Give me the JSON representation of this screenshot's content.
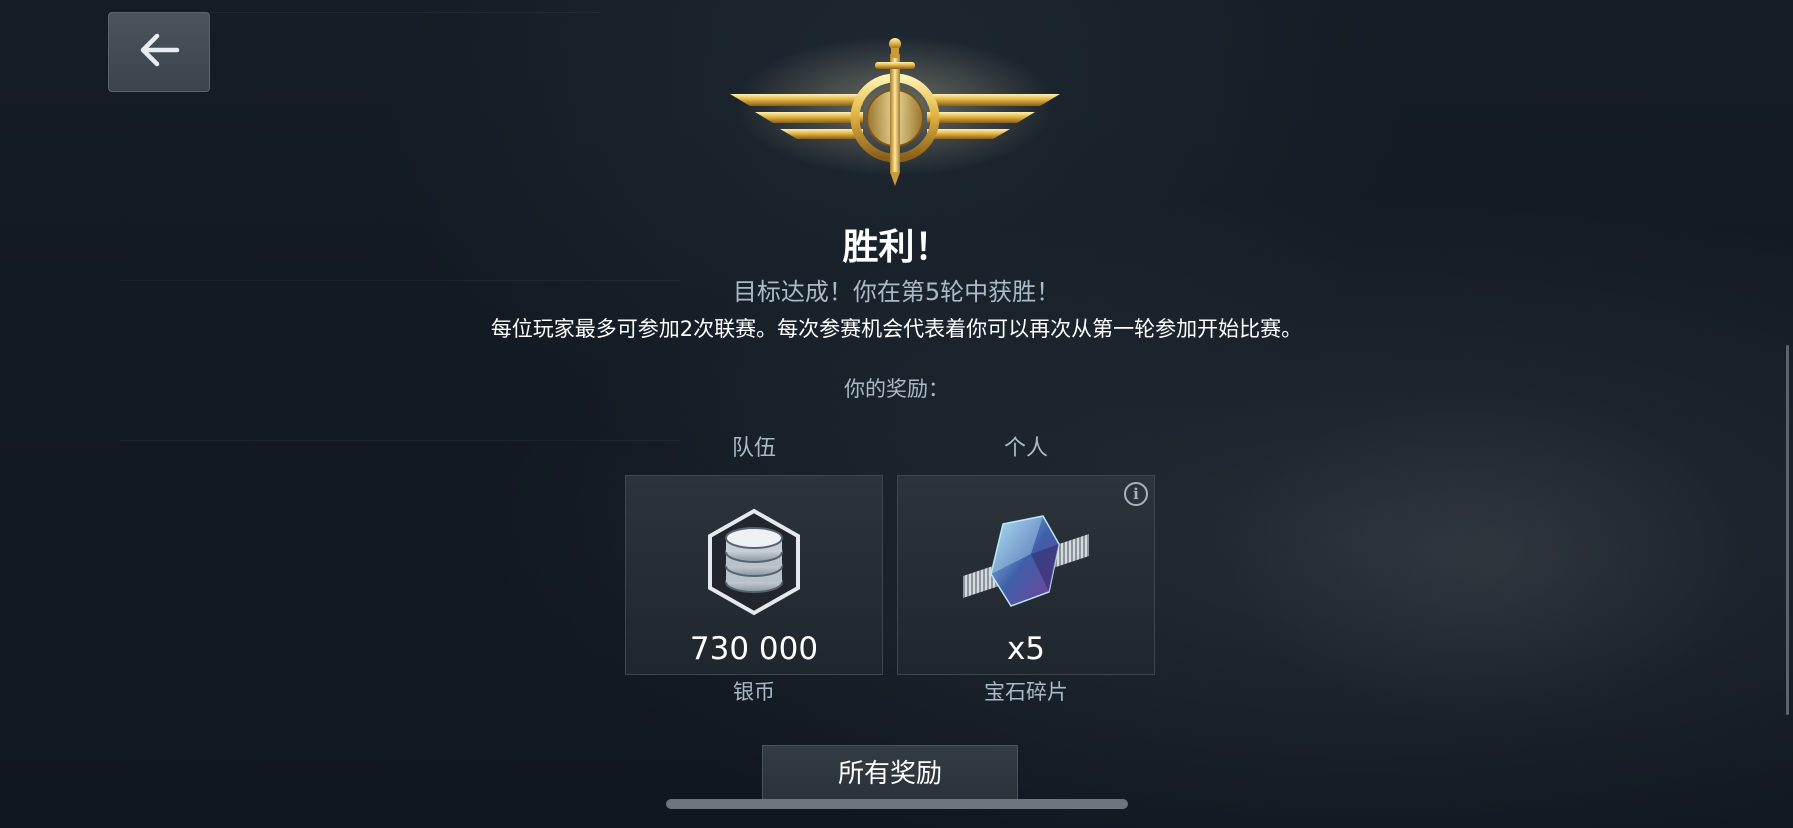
{
  "header": {
    "back_icon": "arrow-left-icon"
  },
  "result": {
    "title": "胜利！",
    "subtitle": "目标达成！你在第5轮中获胜！",
    "description": "每位玩家最多可参加2次联赛。每次参赛机会代表着你可以再次从第一轮参加开始比赛。"
  },
  "rewards": {
    "label": "你的奖励：",
    "team": {
      "column_label": "队伍",
      "amount": "730 000",
      "name": "银币",
      "icon": "silver-coins-icon"
    },
    "personal": {
      "column_label": "个人",
      "amount": "x5",
      "name": "宝石碎片",
      "icon": "gem-fragment-icon",
      "info_icon": "info-icon"
    }
  },
  "all_rewards_button": "所有奖励",
  "colors": {
    "background": "#111820",
    "accent_gold": "#d9a93a",
    "secondary_text": "#a9bac8"
  }
}
